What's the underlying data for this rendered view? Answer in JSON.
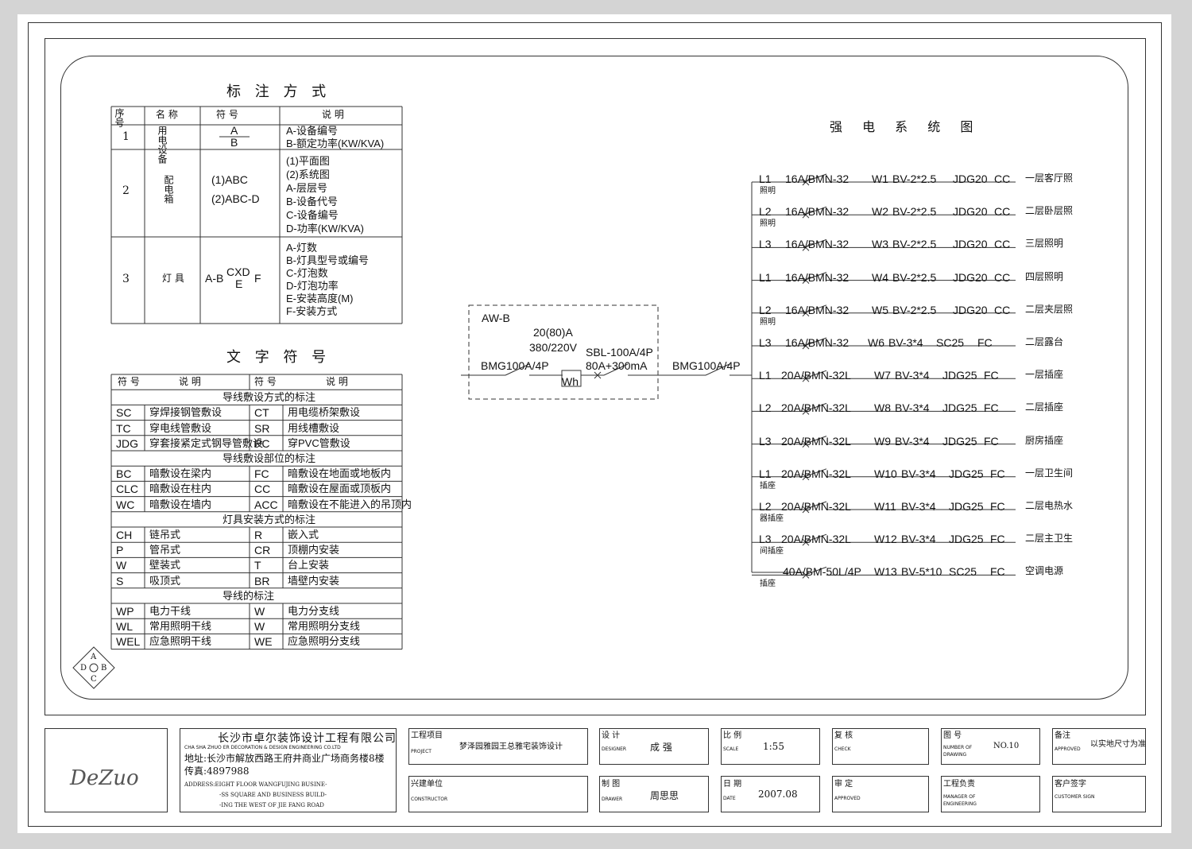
{
  "legend": {
    "title": "标 注 方 式",
    "headers": {
      "no": "序号",
      "name": "名 称",
      "symbol": "符 号",
      "desc": "说 明"
    },
    "rows": [
      {
        "no": "1",
        "name": "用电设备",
        "symbol_top": "A",
        "symbol_bottom": "B",
        "desc": [
          "A-设备编号",
          "B-额定功率(KW/KVA)"
        ]
      },
      {
        "no": "2",
        "name": "配电箱",
        "symbol_1": "(1)ABC",
        "symbol_2": "(2)ABC-D",
        "desc": [
          "(1)平面图",
          "(2)系统图",
          "A-层层号",
          "B-设备代号",
          "C-设备编号",
          "D-功率(KW/KVA)"
        ]
      },
      {
        "no": "3",
        "name": "灯 具",
        "symbol_left": "A-B",
        "symbol_mid": "CXD",
        "symbol_sub": "E",
        "symbol_right": "F",
        "desc": [
          "A-灯数",
          "B-灯具型号或编号",
          "C-灯泡数",
          "D-灯泡功率",
          "E-安装高度(M)",
          "F-安装方式"
        ]
      }
    ]
  },
  "symbols": {
    "title": "文 字 符 号",
    "headers": {
      "sym": "符 号",
      "desc": "说 明"
    },
    "sections": [
      {
        "title": "导线敷设方式的标注",
        "rows": [
          [
            "SC",
            "穿焊接钢管敷设",
            "CT",
            "用电缆桥架敷设"
          ],
          [
            "TC",
            "穿电线管敷设",
            "SR",
            "用线槽敷设"
          ],
          [
            "JDG",
            "穿套接紧定式钢导管敷设",
            "PC",
            "穿PVC管敷设"
          ]
        ]
      },
      {
        "title": "导线敷设部位的标注",
        "rows": [
          [
            "BC",
            "暗敷设在梁内",
            "FC",
            "暗敷设在地面或地板内"
          ],
          [
            "CLC",
            "暗敷设在柱内",
            "CC",
            "暗敷设在屋面或顶板内"
          ],
          [
            "WC",
            "暗敷设在墙内",
            "ACC",
            "暗敷设在不能进入的吊顶内"
          ]
        ]
      },
      {
        "title": "灯具安装方式的标注",
        "rows": [
          [
            "CH",
            "链吊式",
            "R",
            "嵌入式"
          ],
          [
            "P",
            "管吊式",
            "CR",
            "顶棚内安装"
          ],
          [
            "W",
            "壁装式",
            "T",
            "台上安装"
          ],
          [
            "S",
            "吸顶式",
            "BR",
            "墙壁内安装"
          ]
        ]
      },
      {
        "title": "导线的标注",
        "rows": [
          [
            "WP",
            "电力干线",
            "W",
            "电力分支线"
          ],
          [
            "WL",
            "常用照明干线",
            "W",
            "常用照明分支线"
          ],
          [
            "WEL",
            "应急照明干线",
            "WE",
            "应急照明分支线"
          ]
        ]
      }
    ],
    "compass": [
      "A",
      "B",
      "C",
      "D"
    ]
  },
  "system": {
    "title": "强 电 系 统 图",
    "box": {
      "name": "AW-B",
      "meter_rating": "20(80)A",
      "voltage": "380/220V",
      "in_breaker": "BMG100A/4P",
      "meter": "Wh",
      "spd": "SBL-100A/4P",
      "spd_rating": "80A+300mA",
      "out_breaker": "BMG100A/4P"
    },
    "circuits": [
      {
        "phase": "L1",
        "breaker": "16A/BMN-32",
        "wire": "W1",
        "spec": "BV-2*2.5",
        "pipe": "JDG20",
        "lay": "CC",
        "use": "一层客厅照",
        "group": "照明"
      },
      {
        "phase": "L2",
        "breaker": "16A/BMN-32",
        "wire": "W2",
        "spec": "BV-2*2.5",
        "pipe": "JDG20",
        "lay": "CC",
        "use": "二层卧层照",
        "group": "照明"
      },
      {
        "phase": "L3",
        "breaker": "16A/BMN-32",
        "wire": "W3",
        "spec": "BV-2*2.5",
        "pipe": "JDG20",
        "lay": "CC",
        "use": "三层照明",
        "group": ""
      },
      {
        "phase": "L1",
        "breaker": "16A/BMN-32",
        "wire": "W4",
        "spec": "BV-2*2.5",
        "pipe": "JDG20",
        "lay": "CC",
        "use": "四层照明",
        "group": ""
      },
      {
        "phase": "L2",
        "breaker": "16A/BMN-32",
        "wire": "W5",
        "spec": "BV-2*2.5",
        "pipe": "JDG20",
        "lay": "CC",
        "use": "二层夹层照",
        "group": "照明"
      },
      {
        "phase": "L3",
        "breaker": "16A/BMN-32",
        "wire": "W6",
        "spec": "BV-3*4",
        "pipe": "SC25",
        "lay": "FC",
        "use": "二层露台",
        "group": ""
      },
      {
        "phase": "L1",
        "breaker": "20A/BMN-32L",
        "wire": "W7",
        "spec": "BV-3*4",
        "pipe": "JDG25",
        "lay": "FC",
        "use": "一层插座",
        "group": ""
      },
      {
        "phase": "L2",
        "breaker": "20A/BMN-32L",
        "wire": "W8",
        "spec": "BV-3*4",
        "pipe": "JDG25",
        "lay": "FC",
        "use": "二层插座",
        "group": ""
      },
      {
        "phase": "L3",
        "breaker": "20A/BMN-32L",
        "wire": "W9",
        "spec": "BV-3*4",
        "pipe": "JDG25",
        "lay": "FC",
        "use": "厨房插座",
        "group": ""
      },
      {
        "phase": "L1",
        "breaker": "20A/BMN-32L",
        "wire": "W10",
        "spec": "BV-3*4",
        "pipe": "JDG25",
        "lay": "FC",
        "use": "一层卫生间",
        "group": "插座"
      },
      {
        "phase": "L2",
        "breaker": "20A/BMN-32L",
        "wire": "W11",
        "spec": "BV-3*4",
        "pipe": "JDG25",
        "lay": "FC",
        "use": "二层电热水",
        "group": "器插座"
      },
      {
        "phase": "L3",
        "breaker": "20A/BMN-32L",
        "wire": "W12",
        "spec": "BV-3*4",
        "pipe": "JDG25",
        "lay": "FC",
        "use": "二层主卫生",
        "group": "间插座"
      },
      {
        "phase": "",
        "breaker": "40A/BM-50L/4P",
        "wire": "W13",
        "spec": "BV-5*10",
        "pipe": "SC25",
        "lay": "FC",
        "use": "空调电源",
        "group": "插座"
      }
    ]
  },
  "title_block": {
    "company_cn": "长沙市卓尔装饰设计工程有限公司",
    "company_en": "CHA SHA ZHUO ER DECORATION & DESIGN ENGINEERING CO.LTD",
    "address_cn": "地址:长沙市解放西路王府井商业广场商务楼8楼",
    "fax": "传真:4897988",
    "address_en": [
      "ADDRESS:EIGHT FLOOR WANGFUJING BUSINE-",
      "-SS SQUARE AND BUSINESS BUILD-",
      "-ING THE WEST OF JIE FANG ROAD"
    ],
    "logo": "DeZuo",
    "project_label": "工程项目",
    "project_en": "PROJECT",
    "project": "梦泽园雅园王总雅宅装饰设计",
    "constructor_label": "兴建单位",
    "constructor_en": "CONSTRUCTOR",
    "designer_label": "设 计",
    "designer_en": "DESIGNER",
    "designer": "成 强",
    "drawn_label": "制 图",
    "drawn_en": "DRAWER",
    "drawn": "周思思",
    "scale_label": "比 例",
    "scale_en": "SCALE",
    "scale": "1:55",
    "date_label": "日 期",
    "date_en": "DATE",
    "date": "2007.08",
    "check_label": "复 核",
    "check_en": "CHECK",
    "approved_label": "审 定",
    "approved_en": "APPROVED",
    "number_label": "图 号",
    "number_en": [
      "NUMBER OF",
      "DRAWING"
    ],
    "number": "NO.10",
    "manager_label": "工程负责",
    "manager_en": [
      "MANAGER OF",
      "ENGINEERING"
    ],
    "remark_label": "备注",
    "remark_en": "APPROVED",
    "remark": "以实地尺寸为准",
    "client_label": "客户签字",
    "client_en": "CUSTOMER SIGN"
  }
}
